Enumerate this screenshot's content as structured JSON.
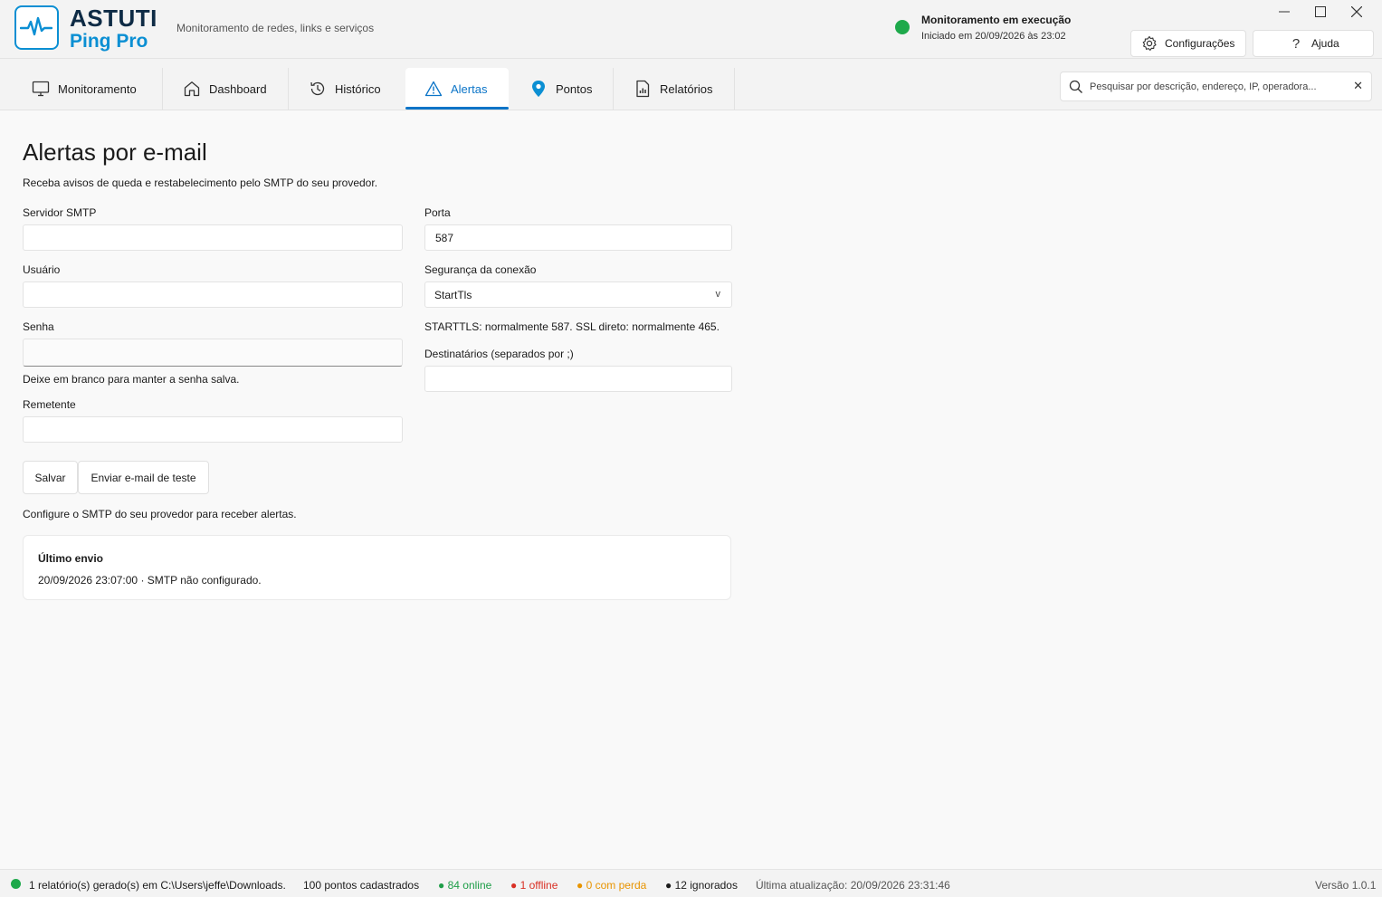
{
  "app": {
    "brand_line1": "ASTUTI",
    "brand_line2": "Ping Pro",
    "tagline": "Monitoramento de redes, links e serviços",
    "accent": "#0b74c7",
    "logo_color": "#0b8fd3"
  },
  "status": {
    "title": "Monitoramento em execução",
    "started": "Iniciado em 20/09/2026 às 23:02",
    "dot_color": "#1ea94b"
  },
  "window_controls": {
    "minimize": "—",
    "maximize": "☐",
    "close": "✕"
  },
  "header_buttons": {
    "settings": "Configurações",
    "help": "Ajuda"
  },
  "tabs": [
    {
      "label": "Monitoramento",
      "icon": "monitor-icon"
    },
    {
      "label": "Dashboard",
      "icon": "home-icon"
    },
    {
      "label": "Histórico",
      "icon": "history-icon"
    },
    {
      "label": "Alertas",
      "icon": "warning-icon",
      "active": true
    },
    {
      "label": "Pontos",
      "icon": "map-pin-icon"
    },
    {
      "label": "Relatórios",
      "icon": "report-icon"
    }
  ],
  "search": {
    "placeholder": "Pesquisar por descrição, endereço, IP, operadora...",
    "value": ""
  },
  "page": {
    "title": "Alertas por e-mail",
    "subtitle": "Receba avisos de queda e restabelecimento pelo SMTP do seu provedor."
  },
  "form": {
    "smtp_server": {
      "label": "Servidor SMTP",
      "value": ""
    },
    "port": {
      "label": "Porta",
      "value": "587"
    },
    "user": {
      "label": "Usuário",
      "value": ""
    },
    "security": {
      "label": "Segurança da conexão",
      "value": "StartTls"
    },
    "security_hint": "STARTTLS: normalmente 587. SSL direto: normalmente 465.",
    "password": {
      "label": "Senha",
      "value": "",
      "hint": "Deixe em branco para manter a senha salva."
    },
    "recipients": {
      "label": "Destinatários (separados por ;)",
      "value": ""
    },
    "sender": {
      "label": "Remetente",
      "value": ""
    }
  },
  "actions": {
    "save": "Salvar",
    "test": "Enviar e-mail de teste"
  },
  "info": "Configure o SMTP do seu provedor para receber alertas.",
  "last_send": {
    "title": "Último envio",
    "text": "20/09/2026 23:07:00 · SMTP não configurado."
  },
  "statusbar": {
    "report": "1 relatório(s) gerado(s) em C:\\Users\\jeffe\\Downloads.",
    "points": "100 pontos cadastrados",
    "online": "● 84 online",
    "offline": "● 1 offline",
    "loss": "● 0 com perda",
    "ignored": "● 12 ignorados",
    "updated": "Última atualização: 20/09/2026 23:31:46",
    "version": "Versão 1.0.1"
  }
}
